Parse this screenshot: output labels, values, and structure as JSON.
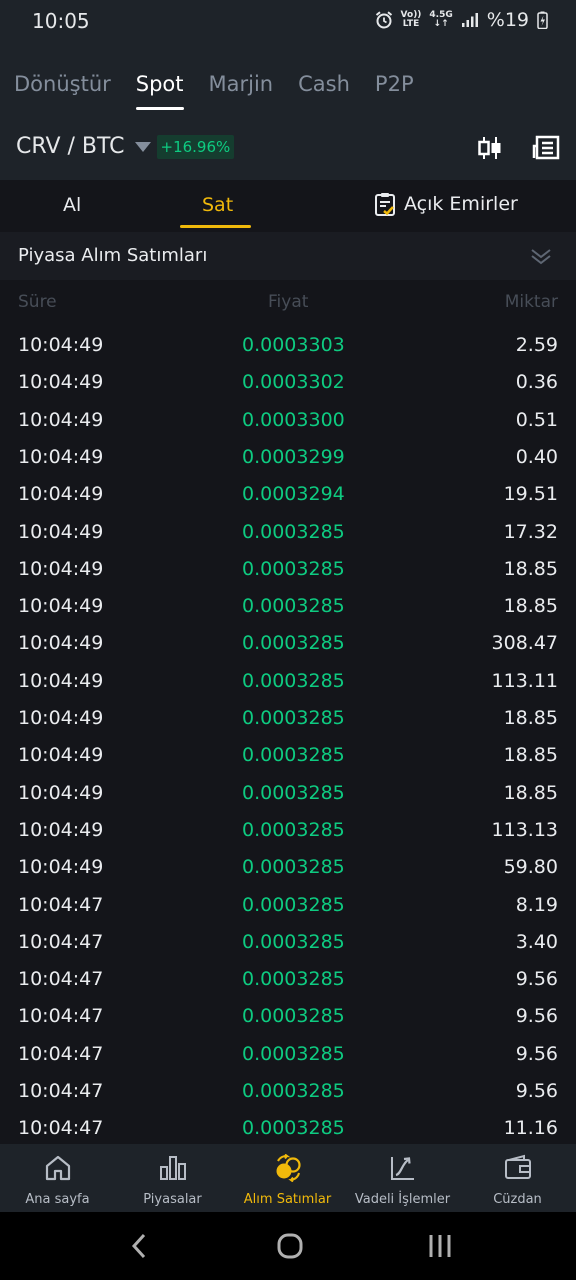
{
  "status_bar": {
    "time": "10:05",
    "net_top": "Vo))",
    "net_bottom": "LTE",
    "gen_top": "4.5G",
    "gen_bottom": "↓↑",
    "battery": "%19"
  },
  "header": {
    "tabs": [
      "Dönüştür",
      "Spot",
      "Marjin",
      "Cash",
      "P2P"
    ],
    "active_tab": "Spot",
    "pair": "CRV / BTC",
    "change": "+16.96%"
  },
  "trade_tabs": {
    "buy": "Al",
    "sell": "Sat",
    "open_orders": "Açık Emirler",
    "active": "Sat"
  },
  "trades_section": {
    "title": "Piyasa Alım Satımları",
    "columns": {
      "time": "Süre",
      "price": "Fiyat",
      "qty": "Miktar"
    },
    "rows": [
      {
        "time": "10:04:49",
        "price": "0.0003303",
        "qty": "2.59"
      },
      {
        "time": "10:04:49",
        "price": "0.0003302",
        "qty": "0.36"
      },
      {
        "time": "10:04:49",
        "price": "0.0003300",
        "qty": "0.51"
      },
      {
        "time": "10:04:49",
        "price": "0.0003299",
        "qty": "0.40"
      },
      {
        "time": "10:04:49",
        "price": "0.0003294",
        "qty": "19.51"
      },
      {
        "time": "10:04:49",
        "price": "0.0003285",
        "qty": "17.32"
      },
      {
        "time": "10:04:49",
        "price": "0.0003285",
        "qty": "18.85"
      },
      {
        "time": "10:04:49",
        "price": "0.0003285",
        "qty": "18.85"
      },
      {
        "time": "10:04:49",
        "price": "0.0003285",
        "qty": "308.47"
      },
      {
        "time": "10:04:49",
        "price": "0.0003285",
        "qty": "113.11"
      },
      {
        "time": "10:04:49",
        "price": "0.0003285",
        "qty": "18.85"
      },
      {
        "time": "10:04:49",
        "price": "0.0003285",
        "qty": "18.85"
      },
      {
        "time": "10:04:49",
        "price": "0.0003285",
        "qty": "18.85"
      },
      {
        "time": "10:04:49",
        "price": "0.0003285",
        "qty": "113.13"
      },
      {
        "time": "10:04:49",
        "price": "0.0003285",
        "qty": "59.80"
      },
      {
        "time": "10:04:47",
        "price": "0.0003285",
        "qty": "8.19"
      },
      {
        "time": "10:04:47",
        "price": "0.0003285",
        "qty": "3.40"
      },
      {
        "time": "10:04:47",
        "price": "0.0003285",
        "qty": "9.56"
      },
      {
        "time": "10:04:47",
        "price": "0.0003285",
        "qty": "9.56"
      },
      {
        "time": "10:04:47",
        "price": "0.0003285",
        "qty": "9.56"
      },
      {
        "time": "10:04:47",
        "price": "0.0003285",
        "qty": "9.56"
      },
      {
        "time": "10:04:47",
        "price": "0.0003285",
        "qty": "11.16"
      }
    ]
  },
  "bottom_nav": [
    {
      "label": "Ana sayfa",
      "icon": "home-icon"
    },
    {
      "label": "Piyasalar",
      "icon": "markets-icon"
    },
    {
      "label": "Alım Satımlar",
      "icon": "trades-icon"
    },
    {
      "label": "Vadeli İşlemler",
      "icon": "futures-icon"
    },
    {
      "label": "Cüzdan",
      "icon": "wallet-icon"
    }
  ],
  "bottom_nav_active": "Alım Satımlar",
  "colors": {
    "accent": "#f0b90b",
    "up": "#0ecb81",
    "background": "#14151a",
    "panel": "#1e2329",
    "muted": "#848e9c"
  }
}
